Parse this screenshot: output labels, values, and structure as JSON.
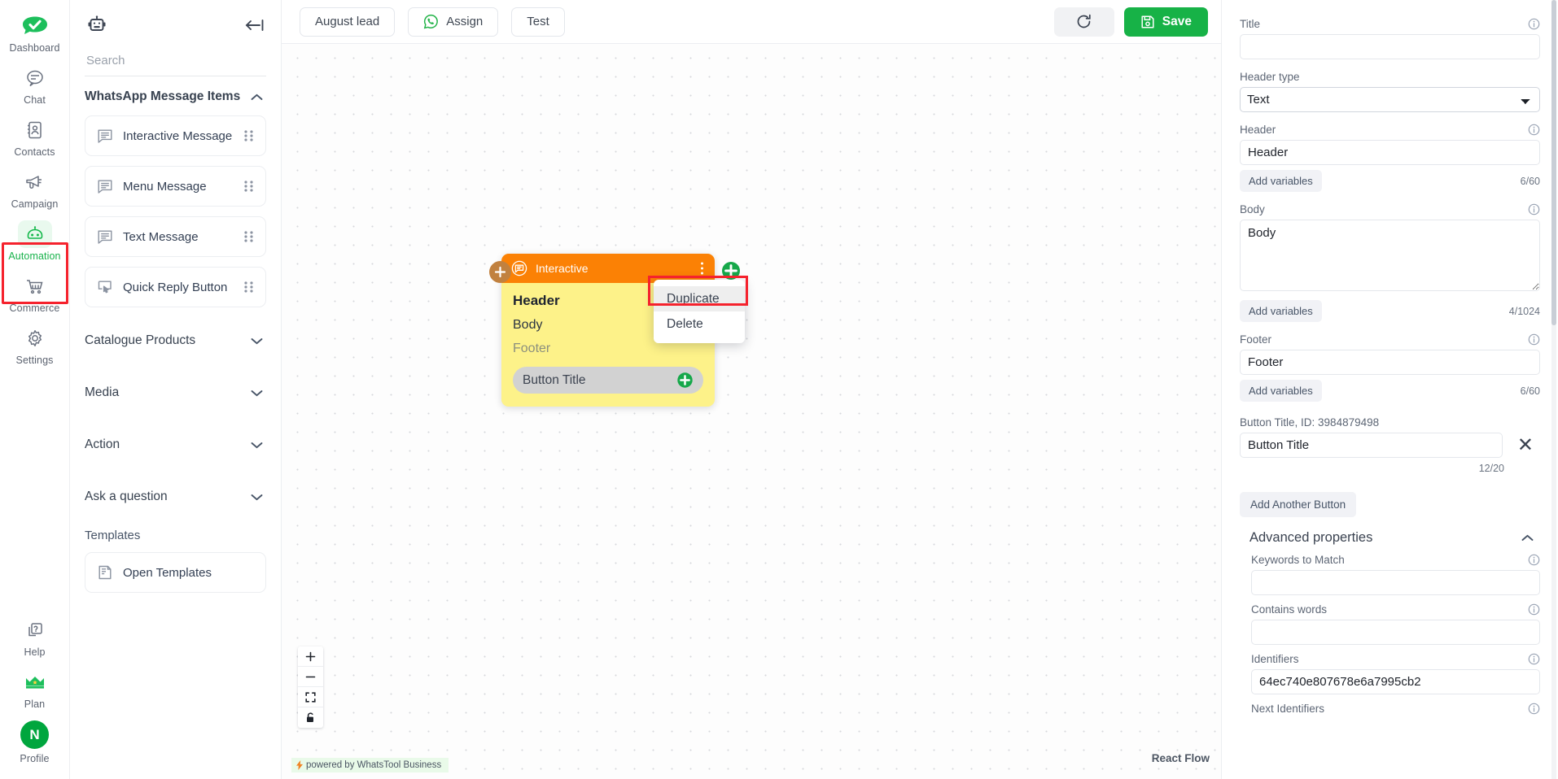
{
  "rail": {
    "items": [
      {
        "label": "Dashboard",
        "icon": "dashboard-logo-icon",
        "active": false
      },
      {
        "label": "Chat",
        "icon": "chat-icon",
        "active": false
      },
      {
        "label": "Contacts",
        "icon": "contacts-icon",
        "active": false
      },
      {
        "label": "Campaign",
        "icon": "megaphone-icon",
        "active": false
      },
      {
        "label": "Automation",
        "icon": "robot-icon",
        "active": true
      },
      {
        "label": "Commerce",
        "icon": "cart-icon",
        "active": false
      },
      {
        "label": "Settings",
        "icon": "gear-icon",
        "active": false
      }
    ],
    "bottom": [
      {
        "label": "Help",
        "icon": "help-icon"
      },
      {
        "label": "Plan",
        "icon": "crown-icon"
      },
      {
        "label": "Profile",
        "icon": "avatar-icon",
        "initial": "N"
      }
    ],
    "active_highlight_color": "#f5222d"
  },
  "panel": {
    "bot_icon": "robot-icon",
    "collapse_icon": "collapse-left-icon",
    "search_placeholder": "Search",
    "sections": [
      {
        "title": "WhatsApp Message Items",
        "expanded": true,
        "chevron": "chevron-up-icon"
      },
      {
        "title": "Catalogue Products",
        "expanded": false,
        "chevron": "chevron-down-icon"
      },
      {
        "title": "Media",
        "expanded": false,
        "chevron": "chevron-down-icon"
      },
      {
        "title": "Action",
        "expanded": false,
        "chevron": "chevron-down-icon"
      },
      {
        "title": "Ask a question",
        "expanded": false,
        "chevron": "chevron-down-icon"
      }
    ],
    "message_items": [
      {
        "label": "Interactive Message",
        "icon": "message-lines-icon"
      },
      {
        "label": "Menu Message",
        "icon": "message-lines-icon"
      },
      {
        "label": "Text Message",
        "icon": "message-lines-icon"
      },
      {
        "label": "Quick Reply Button",
        "icon": "quick-reply-icon"
      }
    ],
    "templates_label": "Templates",
    "templates_item": {
      "label": "Open Templates",
      "icon": "template-icon"
    }
  },
  "topbar": {
    "flow_name": "August lead",
    "assign_label": "Assign",
    "assign_icon": "whatsapp-icon",
    "test_label": "Test",
    "refresh_icon": "refresh-icon",
    "save_label": "Save",
    "save_icon": "save-disk-icon",
    "save_color": "#17b247"
  },
  "node": {
    "type_label": "Interactive",
    "type_icon": "message-lines-icon",
    "menu_icon": "vertical-dots-icon",
    "header": "Header",
    "body": "Body",
    "footer": "Footer",
    "button_title": "Button Title",
    "add_button_icon": "plus-circle-icon",
    "header_color": "#fb8105",
    "body_color": "#fdf289"
  },
  "context_menu": {
    "items": [
      {
        "label": "Duplicate",
        "highlighted": true
      },
      {
        "label": "Delete",
        "highlighted": false
      }
    ],
    "highlight_color": "#f5222d"
  },
  "canvas": {
    "controls": [
      {
        "name": "zoom-in",
        "glyph": "+"
      },
      {
        "name": "zoom-out",
        "glyph": "−"
      },
      {
        "name": "fit-view",
        "glyph": "fit"
      },
      {
        "name": "lock",
        "glyph": "lock"
      }
    ],
    "powered_by": "powered by WhatsTool Business",
    "brand": "React Flow"
  },
  "inspector": {
    "title_label": "Title",
    "title_value": "",
    "header_type_label": "Header type",
    "header_type_value": "Text",
    "header_label": "Header",
    "header_value": "Header",
    "header_counter": "6/60",
    "body_label": "Body",
    "body_value": "Body",
    "body_counter": "4/1024",
    "footer_label": "Footer",
    "footer_value": "Footer",
    "footer_counter": "6/60",
    "add_variables_label": "Add variables",
    "button_title_label": "Button Title, ID: 3984879498",
    "button_title_value": "Button Title",
    "button_title_counter": "12/20",
    "remove_button_icon": "close-x-icon",
    "add_another_button_label": "Add Another Button",
    "advanced_properties_label": "Advanced properties",
    "advanced_chevron": "chevron-up-icon",
    "keywords_label": "Keywords to Match",
    "keywords_value": "",
    "contains_words_label": "Contains words",
    "contains_words_value": "",
    "identifiers_label": "Identifiers",
    "identifiers_value": "64ec740e807678e6a7995cb2",
    "next_identifiers_label": "Next Identifiers",
    "info_icon": "info-circle-icon"
  }
}
